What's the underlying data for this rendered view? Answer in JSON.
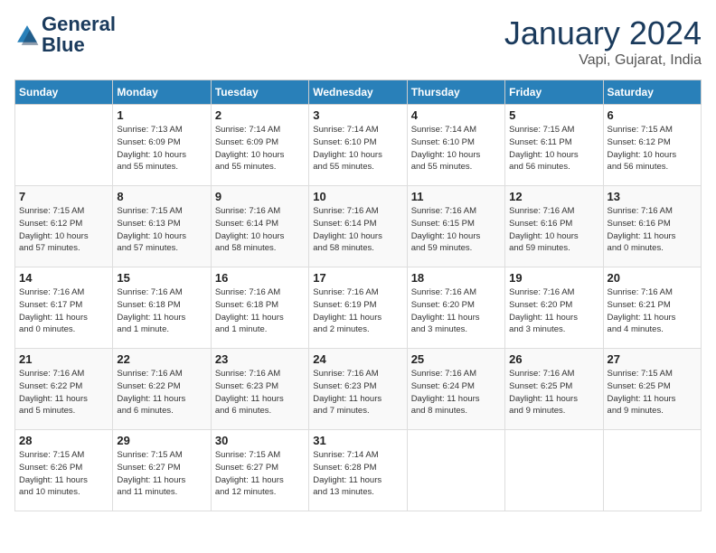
{
  "logo": {
    "general": "General",
    "blue": "Blue"
  },
  "header": {
    "title": "January 2024",
    "subtitle": "Vapi, Gujarat, India"
  },
  "weekdays": [
    "Sunday",
    "Monday",
    "Tuesday",
    "Wednesday",
    "Thursday",
    "Friday",
    "Saturday"
  ],
  "weeks": [
    [
      {
        "day": "",
        "info": ""
      },
      {
        "day": "1",
        "info": "Sunrise: 7:13 AM\nSunset: 6:09 PM\nDaylight: 10 hours\nand 55 minutes."
      },
      {
        "day": "2",
        "info": "Sunrise: 7:14 AM\nSunset: 6:09 PM\nDaylight: 10 hours\nand 55 minutes."
      },
      {
        "day": "3",
        "info": "Sunrise: 7:14 AM\nSunset: 6:10 PM\nDaylight: 10 hours\nand 55 minutes."
      },
      {
        "day": "4",
        "info": "Sunrise: 7:14 AM\nSunset: 6:10 PM\nDaylight: 10 hours\nand 55 minutes."
      },
      {
        "day": "5",
        "info": "Sunrise: 7:15 AM\nSunset: 6:11 PM\nDaylight: 10 hours\nand 56 minutes."
      },
      {
        "day": "6",
        "info": "Sunrise: 7:15 AM\nSunset: 6:12 PM\nDaylight: 10 hours\nand 56 minutes."
      }
    ],
    [
      {
        "day": "7",
        "info": "Sunrise: 7:15 AM\nSunset: 6:12 PM\nDaylight: 10 hours\nand 57 minutes."
      },
      {
        "day": "8",
        "info": "Sunrise: 7:15 AM\nSunset: 6:13 PM\nDaylight: 10 hours\nand 57 minutes."
      },
      {
        "day": "9",
        "info": "Sunrise: 7:16 AM\nSunset: 6:14 PM\nDaylight: 10 hours\nand 58 minutes."
      },
      {
        "day": "10",
        "info": "Sunrise: 7:16 AM\nSunset: 6:14 PM\nDaylight: 10 hours\nand 58 minutes."
      },
      {
        "day": "11",
        "info": "Sunrise: 7:16 AM\nSunset: 6:15 PM\nDaylight: 10 hours\nand 59 minutes."
      },
      {
        "day": "12",
        "info": "Sunrise: 7:16 AM\nSunset: 6:16 PM\nDaylight: 10 hours\nand 59 minutes."
      },
      {
        "day": "13",
        "info": "Sunrise: 7:16 AM\nSunset: 6:16 PM\nDaylight: 11 hours\nand 0 minutes."
      }
    ],
    [
      {
        "day": "14",
        "info": "Sunrise: 7:16 AM\nSunset: 6:17 PM\nDaylight: 11 hours\nand 0 minutes."
      },
      {
        "day": "15",
        "info": "Sunrise: 7:16 AM\nSunset: 6:18 PM\nDaylight: 11 hours\nand 1 minute."
      },
      {
        "day": "16",
        "info": "Sunrise: 7:16 AM\nSunset: 6:18 PM\nDaylight: 11 hours\nand 1 minute."
      },
      {
        "day": "17",
        "info": "Sunrise: 7:16 AM\nSunset: 6:19 PM\nDaylight: 11 hours\nand 2 minutes."
      },
      {
        "day": "18",
        "info": "Sunrise: 7:16 AM\nSunset: 6:20 PM\nDaylight: 11 hours\nand 3 minutes."
      },
      {
        "day": "19",
        "info": "Sunrise: 7:16 AM\nSunset: 6:20 PM\nDaylight: 11 hours\nand 3 minutes."
      },
      {
        "day": "20",
        "info": "Sunrise: 7:16 AM\nSunset: 6:21 PM\nDaylight: 11 hours\nand 4 minutes."
      }
    ],
    [
      {
        "day": "21",
        "info": "Sunrise: 7:16 AM\nSunset: 6:22 PM\nDaylight: 11 hours\nand 5 minutes."
      },
      {
        "day": "22",
        "info": "Sunrise: 7:16 AM\nSunset: 6:22 PM\nDaylight: 11 hours\nand 6 minutes."
      },
      {
        "day": "23",
        "info": "Sunrise: 7:16 AM\nSunset: 6:23 PM\nDaylight: 11 hours\nand 6 minutes."
      },
      {
        "day": "24",
        "info": "Sunrise: 7:16 AM\nSunset: 6:23 PM\nDaylight: 11 hours\nand 7 minutes."
      },
      {
        "day": "25",
        "info": "Sunrise: 7:16 AM\nSunset: 6:24 PM\nDaylight: 11 hours\nand 8 minutes."
      },
      {
        "day": "26",
        "info": "Sunrise: 7:16 AM\nSunset: 6:25 PM\nDaylight: 11 hours\nand 9 minutes."
      },
      {
        "day": "27",
        "info": "Sunrise: 7:15 AM\nSunset: 6:25 PM\nDaylight: 11 hours\nand 9 minutes."
      }
    ],
    [
      {
        "day": "28",
        "info": "Sunrise: 7:15 AM\nSunset: 6:26 PM\nDaylight: 11 hours\nand 10 minutes."
      },
      {
        "day": "29",
        "info": "Sunrise: 7:15 AM\nSunset: 6:27 PM\nDaylight: 11 hours\nand 11 minutes."
      },
      {
        "day": "30",
        "info": "Sunrise: 7:15 AM\nSunset: 6:27 PM\nDaylight: 11 hours\nand 12 minutes."
      },
      {
        "day": "31",
        "info": "Sunrise: 7:14 AM\nSunset: 6:28 PM\nDaylight: 11 hours\nand 13 minutes."
      },
      {
        "day": "",
        "info": ""
      },
      {
        "day": "",
        "info": ""
      },
      {
        "day": "",
        "info": ""
      }
    ]
  ]
}
